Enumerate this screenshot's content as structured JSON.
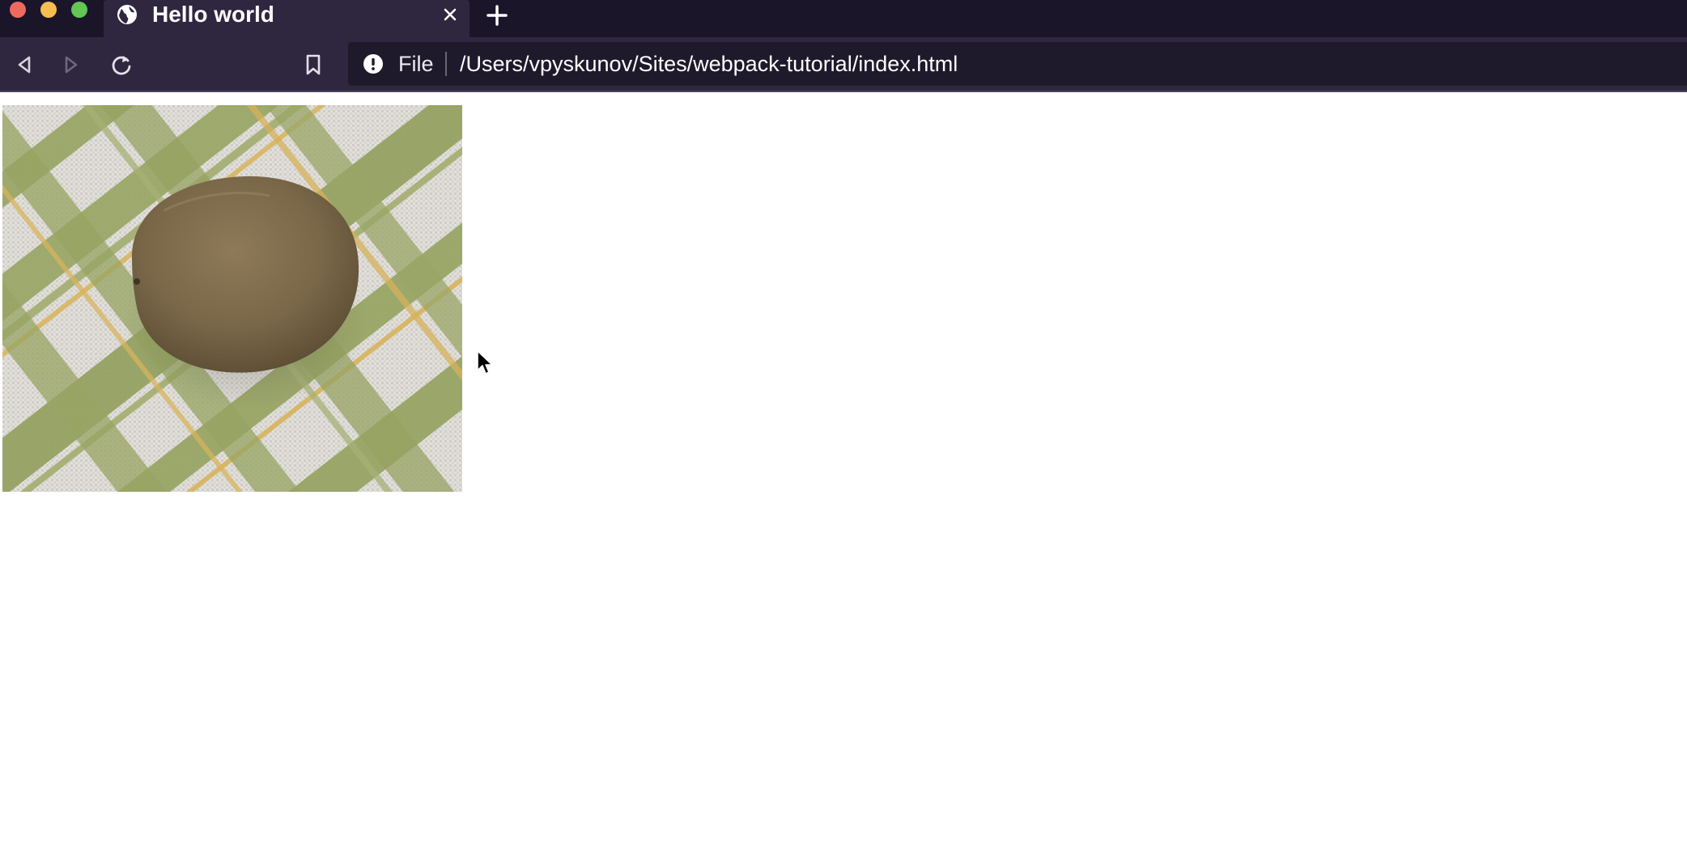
{
  "browser": {
    "tab": {
      "title": "Hello world",
      "favicon": "globe-icon"
    },
    "toolbar": {
      "back_icon": "back-arrow-icon",
      "forward_icon": "forward-arrow-icon",
      "reload_icon": "reload-icon",
      "bookmark_icon": "bookmark-icon"
    },
    "urlbar": {
      "info_icon": "info-icon",
      "scheme_label": "File",
      "url": "/Users/vpyskunov/Sites/webpack-tutorial/index.html"
    }
  },
  "page": {
    "image": "kiwi fruit on green and white plaid tablecloth"
  },
  "colors": {
    "tabstrip_bg": "#1a1529",
    "toolbar_bg": "#2f2740",
    "urlbar_bg": "#1e1a2b",
    "close_dot": "#ee6a5e",
    "minimize_dot": "#f5be4f",
    "maximize_dot": "#62c554",
    "page_bg": "#ffffff"
  }
}
